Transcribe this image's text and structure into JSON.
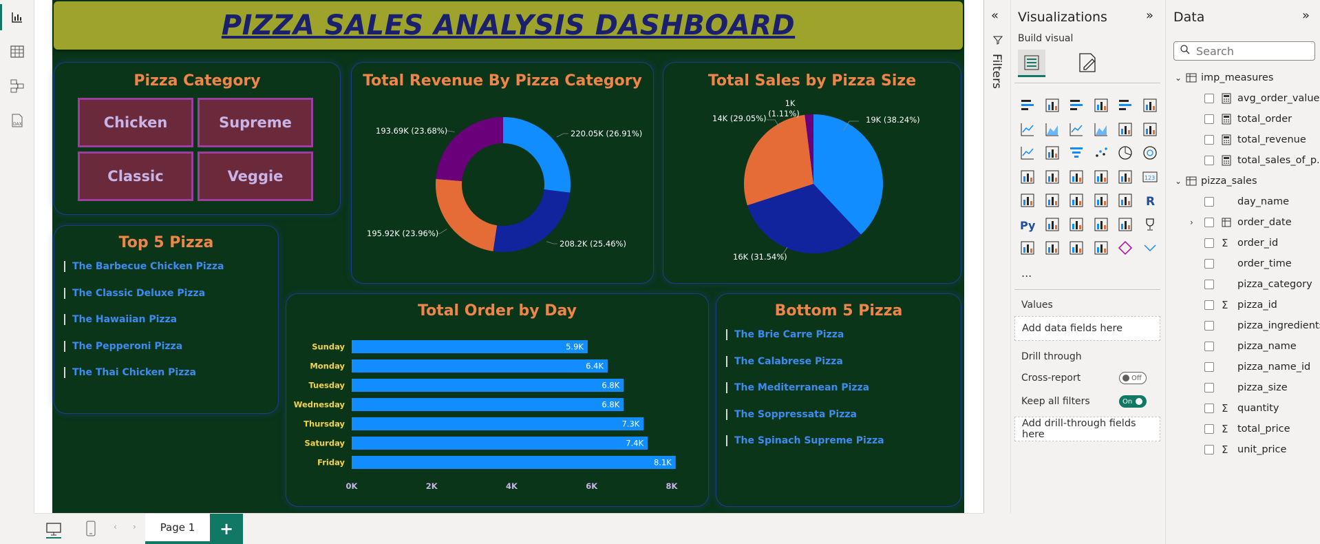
{
  "dashboard": {
    "title": "PIZZA SALES ANALYSIS DASHBOARD"
  },
  "category_card": {
    "title": "Pizza Category",
    "tiles": [
      "Chicken",
      "Supreme",
      "Classic",
      "Veggie"
    ]
  },
  "top5": {
    "title": "Top 5 Pizza",
    "items": [
      "The Barbecue Chicken Pizza",
      "The Classic Deluxe Pizza",
      "The Hawaiian Pizza",
      "The Pepperoni Pizza",
      "The Thai Chicken Pizza"
    ]
  },
  "bottom5": {
    "title": "Bottom 5 Pizza",
    "items": [
      "The Brie Carre Pizza",
      "The Calabrese Pizza",
      "The Mediterranean Pizza",
      "The Soppressata Pizza",
      "The Spinach Supreme Pizza"
    ]
  },
  "colors": {
    "background": "#0a3519",
    "banner": "#9ea32b",
    "title_text": "#1a1f6e",
    "card_title": "#f0854a",
    "tile_fill": "#6b2a3c",
    "tile_border": "#9a3fa0",
    "bar": "#118dff",
    "accent": "#117865"
  },
  "chart_data": [
    {
      "type": "pie",
      "variant": "donut",
      "title": "Total Revenue By Pizza Category",
      "slices": [
        {
          "value": 220.05,
          "label": "220.05K (26.91%)",
          "color": "#118dff"
        },
        {
          "value": 208.2,
          "label": "208.2K (25.46%)",
          "color": "#12239e"
        },
        {
          "value": 195.92,
          "label": "195.92K (23.96%)",
          "color": "#e66c37"
        },
        {
          "value": 193.69,
          "label": "193.69K (23.68%)",
          "color": "#6b007b"
        }
      ]
    },
    {
      "type": "pie",
      "title": "Total Sales by Pizza Size",
      "slices": [
        {
          "value": 19,
          "label": "19K (38.24%)",
          "color": "#118dff"
        },
        {
          "value": 16,
          "label": "16K (31.54%)",
          "color": "#12239e"
        },
        {
          "value": 14,
          "label": "14K (29.05%)",
          "color": "#e66c37"
        },
        {
          "value": 1,
          "label": "1K (1.11%)",
          "label_line1": "1K",
          "label_line2": "(1.11%)",
          "color": "#6b007b"
        }
      ]
    },
    {
      "type": "bar",
      "orientation": "horizontal",
      "title": "Total Order by Day",
      "categories": [
        "Sunday",
        "Monday",
        "Tuesday",
        "Wednesday",
        "Thursday",
        "Saturday",
        "Friday"
      ],
      "values": [
        5.9,
        6.4,
        6.8,
        6.8,
        7.3,
        7.4,
        8.1
      ],
      "data_labels": [
        "5.9K",
        "6.4K",
        "6.8K",
        "6.8K",
        "7.3K",
        "7.4K",
        "8.1K"
      ],
      "xlim": [
        0,
        8
      ],
      "xticks": [
        "0K",
        "2K",
        "4K",
        "6K",
        "8K"
      ],
      "color": "#118dff"
    }
  ],
  "filters_pane": {
    "label": "Filters"
  },
  "visualizations": {
    "title": "Visualizations",
    "build_visual": "Build visual",
    "more": "...",
    "values_label": "Values",
    "add_data_fields": "Add data fields here",
    "drill_through": "Drill through",
    "cross_report": "Cross-report",
    "cross_report_state": "Off",
    "keep_all_filters": "Keep all filters",
    "keep_all_filters_state": "On",
    "add_drill_through": "Add drill-through fields here"
  },
  "data_pane": {
    "title": "Data",
    "search_placeholder": "Search",
    "tables": [
      {
        "name": "imp_measures",
        "fields": [
          "avg_order_value",
          "total_order",
          "total_revenue",
          "total_sales_of_p..."
        ]
      },
      {
        "name": "pizza_sales",
        "fields": [
          "day_name",
          "order_date",
          "order_id",
          "order_time",
          "pizza_category",
          "pizza_id",
          "pizza_ingredients",
          "pizza_name",
          "pizza_name_id",
          "pizza_size",
          "quantity",
          "total_price",
          "unit_price"
        ]
      }
    ]
  },
  "pages": {
    "current": "Page 1",
    "add": "+"
  }
}
